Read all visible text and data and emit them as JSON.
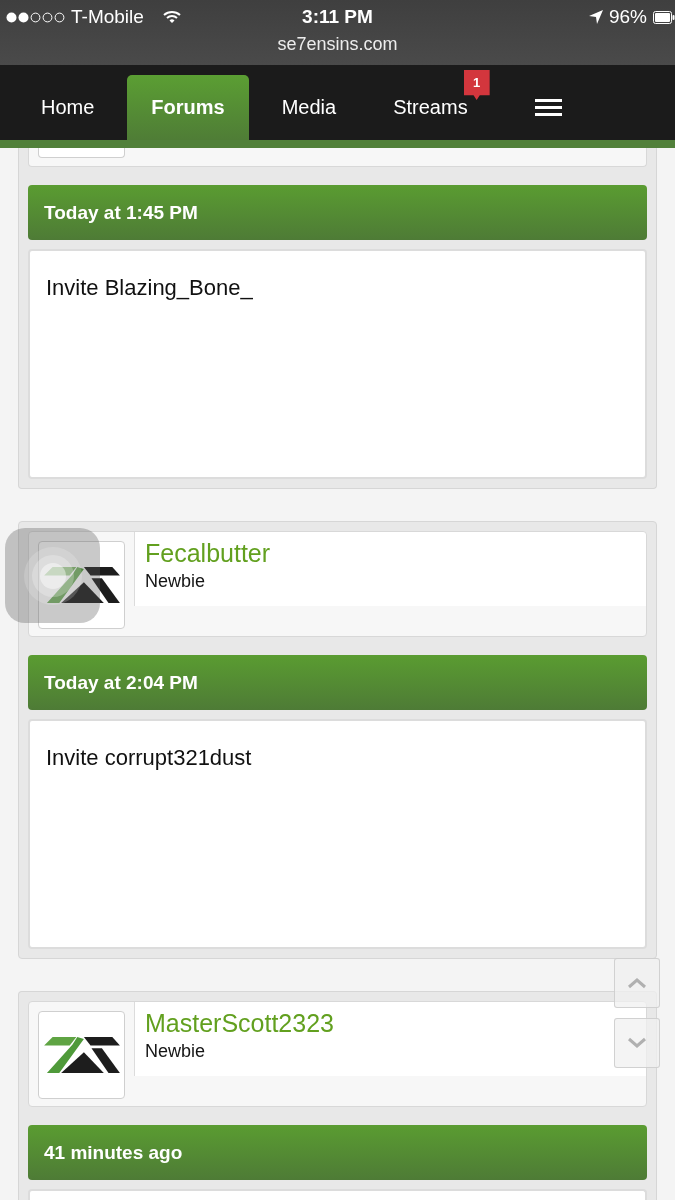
{
  "status_bar": {
    "carrier": "T-Mobile",
    "time": "3:11 PM",
    "battery": "96%"
  },
  "address_bar": {
    "url": "se7ensins.com"
  },
  "nav": {
    "tabs": [
      {
        "label": "Home",
        "selected": false
      },
      {
        "label": "Forums",
        "selected": true
      },
      {
        "label": "Media",
        "selected": false
      },
      {
        "label": "Streams",
        "selected": false,
        "badge": "1"
      }
    ]
  },
  "posts": [
    {
      "kind": "clipped",
      "date": "Today at 1:45 PM",
      "message": "Invite Blazing_Bone_"
    },
    {
      "kind": "full",
      "author": "Fecalbutter",
      "rank": "Newbie",
      "date": "Today at 2:04 PM",
      "message": "Invite corrupt321dust"
    },
    {
      "kind": "full",
      "author": "MasterScott2323",
      "rank": "Newbie",
      "date": "41 minutes ago"
    }
  ]
}
